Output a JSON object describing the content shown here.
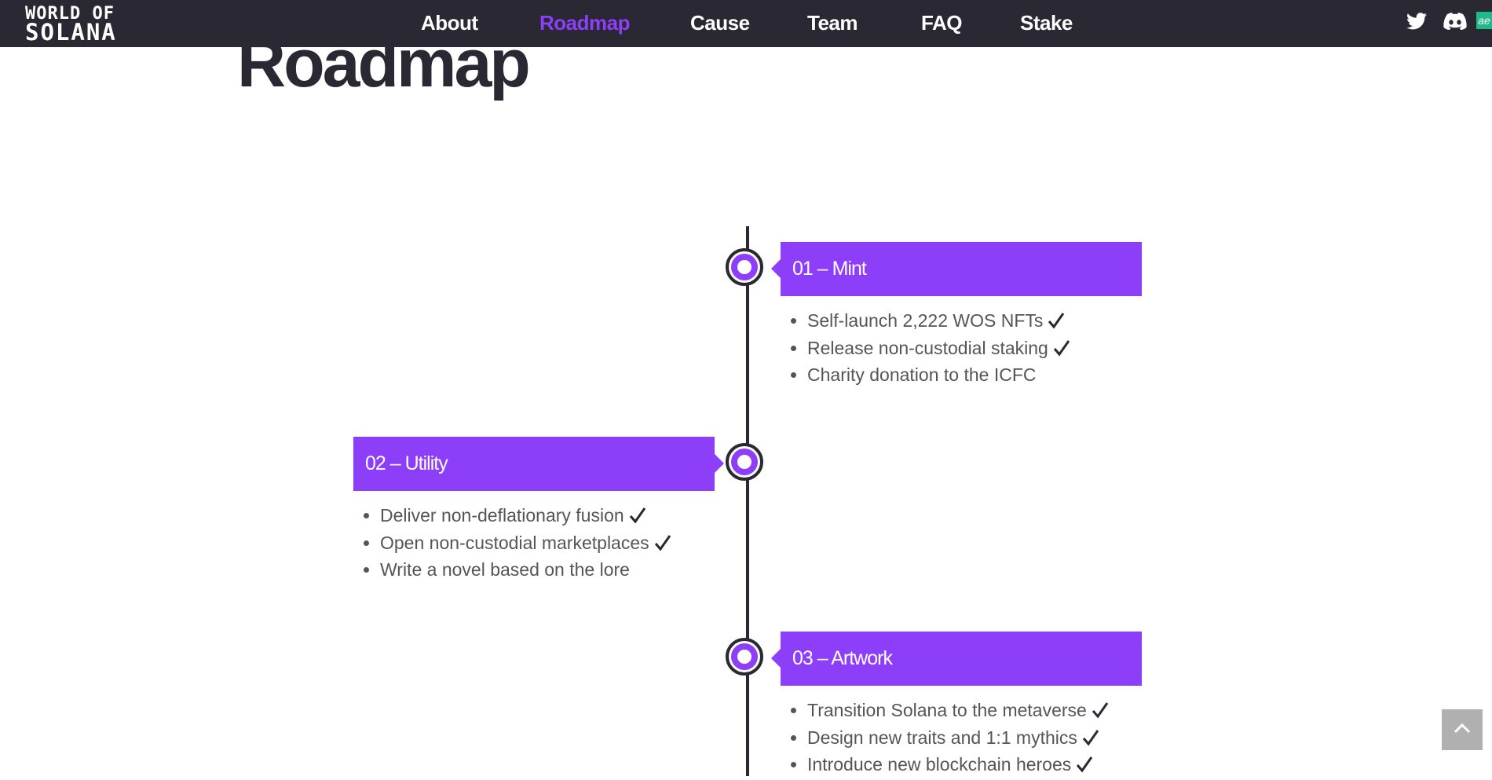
{
  "logo": {
    "line1": "WORLD OF",
    "line2": "SOLANA"
  },
  "nav": {
    "items": [
      {
        "label": "About"
      },
      {
        "label": "Roadmap"
      },
      {
        "label": "Cause"
      },
      {
        "label": "Team"
      },
      {
        "label": "FAQ"
      },
      {
        "label": "Stake"
      }
    ],
    "active": "Roadmap"
  },
  "social": {
    "icons": [
      "twitter-icon",
      "discord-icon"
    ],
    "badge": "ae"
  },
  "heading": "Roadmap",
  "phases": [
    {
      "title": "01 – Mint",
      "items": [
        {
          "text": "Self-launch 2,222 WOS NFTs",
          "done": true
        },
        {
          "text": "Release non-custodial staking",
          "done": true
        },
        {
          "text": "Charity donation to the ICFC",
          "done": false
        }
      ]
    },
    {
      "title": "02 – Utility",
      "items": [
        {
          "text": "Deliver non-deflationary fusion",
          "done": true
        },
        {
          "text": "Open non-custodial marketplaces",
          "done": true
        },
        {
          "text": "Write a novel based on the lore",
          "done": false
        }
      ]
    },
    {
      "title": "03 – Artwork",
      "items": [
        {
          "text": "Transition Solana to the metaverse",
          "done": true
        },
        {
          "text": "Design new traits and 1:1 mythics",
          "done": true
        },
        {
          "text": "Introduce new blockchain heroes",
          "done": true
        }
      ]
    }
  ],
  "colors": {
    "accent": "#8d3ef8",
    "dark": "#2a2933",
    "text": "#555555"
  }
}
